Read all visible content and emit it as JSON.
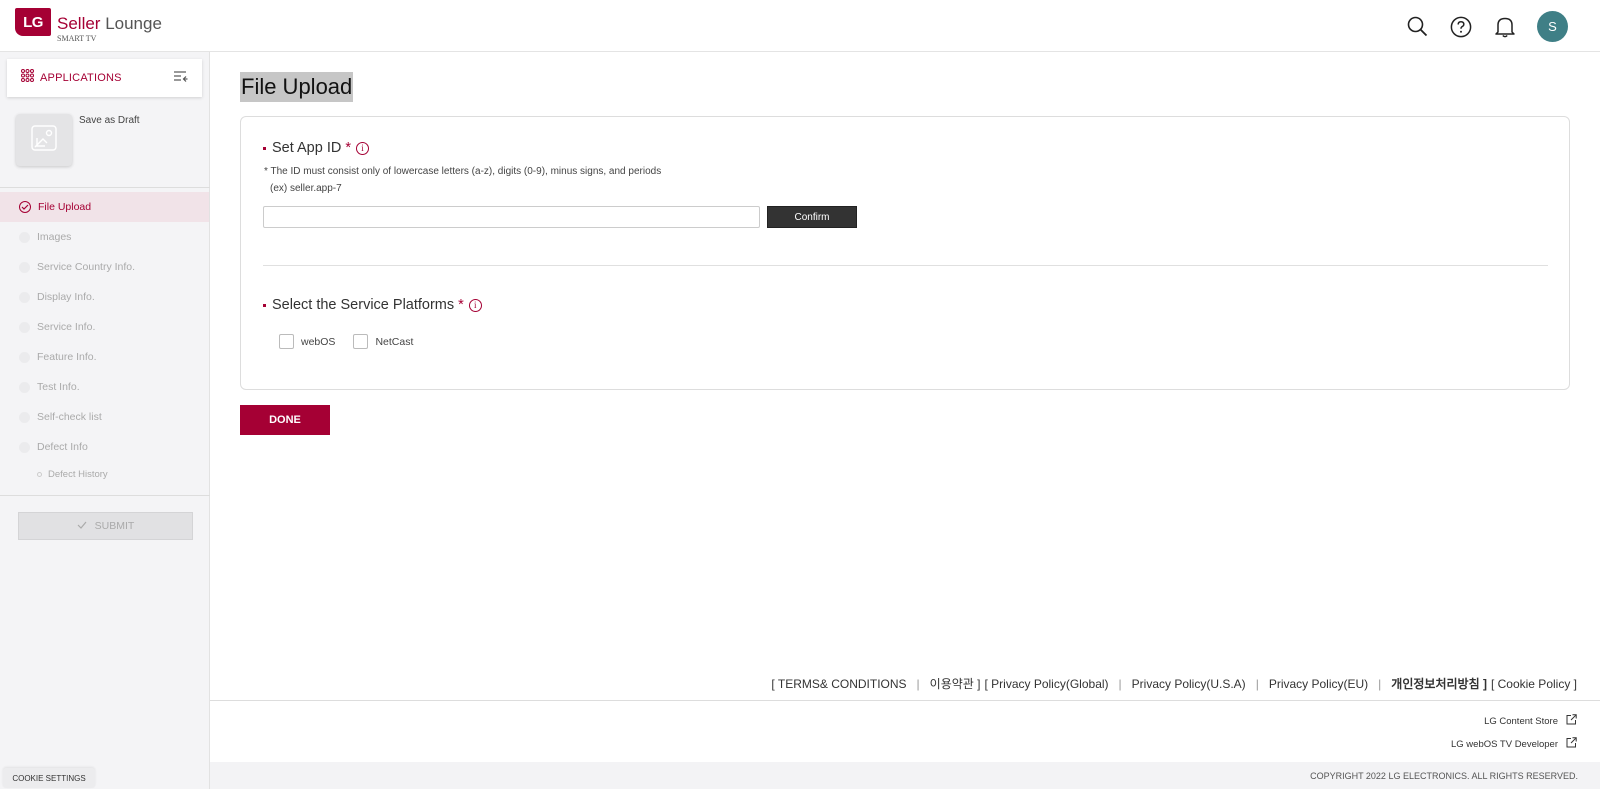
{
  "header": {
    "logo_mark": "LG",
    "brand_accent": "Seller",
    "brand_rest": " Lounge",
    "brand_sub": "SMART TV",
    "avatar_initial": "S",
    "icons": [
      "search-icon",
      "help-icon",
      "bell-icon"
    ]
  },
  "sidebar": {
    "apps_label": "APPLICATIONS",
    "draft_label": "Save as Draft",
    "steps": [
      {
        "label": "File Upload",
        "active": true
      },
      {
        "label": "Images"
      },
      {
        "label": "Service Country Info."
      },
      {
        "label": "Display Info."
      },
      {
        "label": "Service Info."
      },
      {
        "label": "Feature Info."
      },
      {
        "label": "Test Info."
      },
      {
        "label": "Self-check list"
      },
      {
        "label": "Defect Info"
      }
    ],
    "substep": "Defect History",
    "submit_label": "SUBMIT",
    "cookie_label": "COOKIE SETTINGS"
  },
  "main": {
    "title": "File Upload",
    "app_id": {
      "title": "Set App ID",
      "required": "*",
      "hint1": "* The ID must consist only of lowercase letters (a-z), digits (0-9), minus signs, and periods",
      "hint2": "(ex) seller.app-7",
      "value": "",
      "confirm_label": "Confirm"
    },
    "platforms": {
      "title": "Select the Service Platforms",
      "required": "*",
      "options": [
        "webOS",
        "NetCast"
      ]
    },
    "done_label": "DONE"
  },
  "footer": {
    "links": {
      "terms": "[ TERMS& CONDITIONS",
      "terms_kr": "이용약관 ]",
      "privacy_global": "[ Privacy Policy(Global)",
      "privacy_usa": "Privacy Policy(U.S.A)",
      "privacy_eu": "Privacy Policy(EU)",
      "privacy_kr": "개인정보처리방침 ]",
      "cookie": "[ Cookie Policy ]",
      "sep": "|"
    },
    "content_store": "LG Content Store",
    "developer": "LG webOS TV Developer",
    "copyright": "COPYRIGHT 2022 LG ELECTRONICS. ALL RIGHTS RESERVED."
  },
  "colors": {
    "brand": "#a50034",
    "avatar": "#3f7f86",
    "confirm": "#333333"
  }
}
